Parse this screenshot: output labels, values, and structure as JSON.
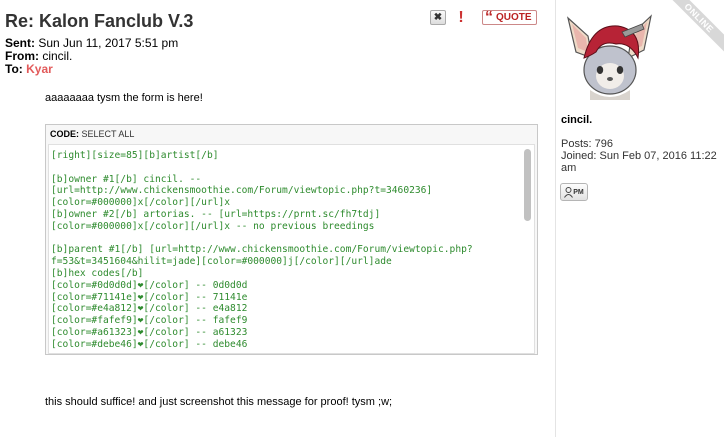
{
  "post": {
    "title": "Re: Kalon Fanclub V.3",
    "sent_label": "Sent:",
    "sent_value": "Sun Jun 11, 2017 5:51 pm",
    "from_label": "From:",
    "from_value": "cincil.",
    "to_label": "To:",
    "to_value": "Kyar",
    "body_text": "aaaaaaaa tysm the form is here!",
    "footer_text": "this should suffice! and just screenshot this message for proof! tysm ;w;"
  },
  "actions": {
    "close_glyph": "✖",
    "report_glyph": "!",
    "quote_mark": "“",
    "quote_label": "QUOTE"
  },
  "code": {
    "label": "CODE:",
    "select_all": "SELECT ALL",
    "lines": [
      "[right][size=85][b]artist[/b]",
      "",
      "[b]owner #1[/b] cincil. --",
      "[url=http://www.chickensmoothie.com/Forum/viewtopic.php?t=3460236]",
      "[color=#000000]x[/color][/url]x",
      "[b]owner #2[/b] artorias. -- [url=https://prnt.sc/fh7tdj]",
      "[color=#000000]x[/color][/url]x -- no previous breedings",
      "",
      "[b]parent #1[/b] [url=http://www.chickensmoothie.com/Forum/viewtopic.php?",
      "f=53&t=3451604&hilit=jade][color=#000000]j[/color][/url]ade",
      "[b]hex codes[/b]",
      "[color=#0d0d0d]❤[/color] -- 0d0d0d",
      "[color=#71141e]❤[/color] -- 71141e",
      "[color=#e4a812]❤[/color] -- e4a812",
      "[color=#fafef9]❤[/color] -- fafef9",
      "[color=#a61323]❤[/color] -- a61323",
      "[color=#debe46]❤[/color] -- debe46"
    ]
  },
  "profile": {
    "online_label": "ONLINE",
    "username": "cincil.",
    "posts_label": "Posts:",
    "posts_value": "796",
    "joined_label": "Joined:",
    "joined_value": "Sun Feb 07, 2016 11:22 am",
    "pm_label": "PM"
  },
  "colors": {
    "recipient": "#e25a5a",
    "code_text": "#2e8b2e",
    "quote_accent": "#b22222"
  }
}
